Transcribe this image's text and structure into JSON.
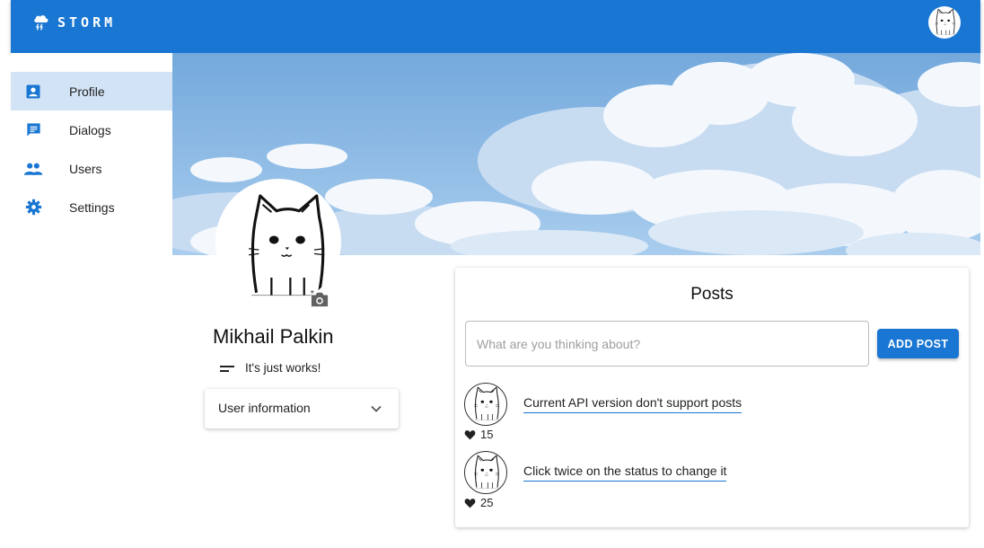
{
  "app": {
    "brand": "STORM"
  },
  "sidebar": {
    "items": [
      {
        "label": "Profile",
        "icon": "account-box-icon",
        "active": true
      },
      {
        "label": "Dialogs",
        "icon": "message-icon",
        "active": false
      },
      {
        "label": "Users",
        "icon": "people-icon",
        "active": false
      },
      {
        "label": "Settings",
        "icon": "gear-icon",
        "active": false
      }
    ]
  },
  "profile": {
    "name": "Mikhail Palkin",
    "status": "It's just works!",
    "user_info_label": "User information"
  },
  "posts": {
    "title": "Posts",
    "input_placeholder": "What are you thinking about?",
    "add_button": "ADD POST",
    "items": [
      {
        "text": "Current API version don't support posts",
        "likes": "15"
      },
      {
        "text": "Click twice on the status to change it",
        "likes": "25"
      }
    ]
  },
  "colors": {
    "primary": "#1976d2",
    "active_nav": "#d3e3f6",
    "sky": "#8ab8e4"
  }
}
